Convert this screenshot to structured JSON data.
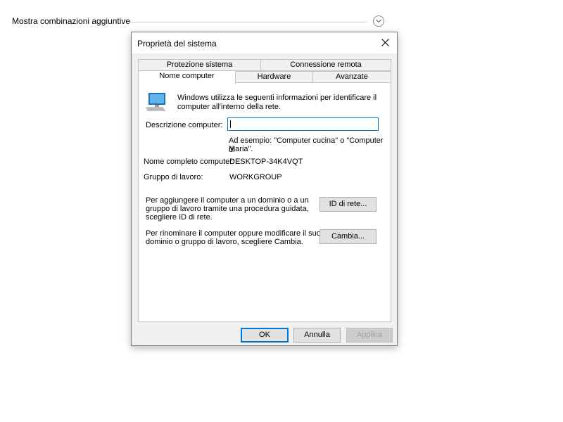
{
  "background": {
    "more_combinations_label": "Mostra combinazioni aggiuntive",
    "expand_icon": "chevron-down-icon"
  },
  "dialog": {
    "title": "Proprietà del sistema",
    "close_icon": "close-icon",
    "tabs_top": [
      "Protezione sistema",
      "Connessione remota"
    ],
    "tabs_bottom": [
      "Nome computer",
      "Hardware",
      "Avanzate"
    ],
    "active_tab": "Nome computer"
  },
  "computer_name_tab": {
    "intro_icon": "computer-monitor-icon",
    "intro_line1": "Windows utilizza le seguenti informazioni per identificare il",
    "intro_line2": "computer all'interno della rete.",
    "description_label": "Descrizione computer:",
    "description_value": "",
    "example_line1": "Ad esempio: \"Computer cucina\" o \"Computer di",
    "example_line2": "Maria\".",
    "full_name_label": "Nome completo computer:",
    "full_name_value": "DESKTOP-34K4VQT",
    "workgroup_label": "Gruppo di lavoro:",
    "workgroup_value": "WORKGROUP",
    "network_id_text_line1": "Per aggiungere il computer a un dominio o a un",
    "network_id_text_line2": "gruppo di lavoro tramite una procedura guidata,",
    "network_id_text_line3": "scegliere ID di rete.",
    "network_id_button": "ID di rete...",
    "rename_text_line1": "Per rinominare il computer oppure modificare il suo",
    "rename_text_line2": "dominio o gruppo di lavoro, scegliere Cambia.",
    "change_button": "Cambia..."
  },
  "footer": {
    "ok_button": "OK",
    "cancel_button": "Annulla",
    "apply_button": "Applica"
  }
}
